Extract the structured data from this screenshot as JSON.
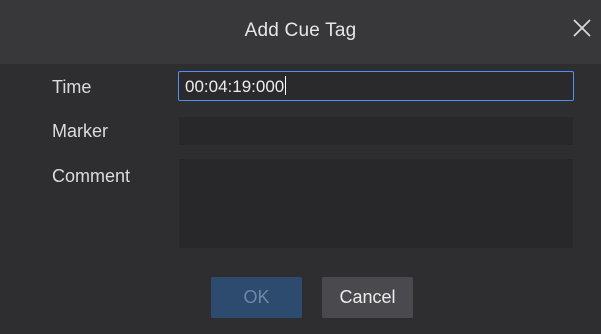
{
  "dialog": {
    "title": "Add Cue Tag",
    "close_icon": "close-icon"
  },
  "form": {
    "time_label": "Time",
    "time_value": "00:04:19:000",
    "marker_label": "Marker",
    "marker_value": "",
    "comment_label": "Comment",
    "comment_value": ""
  },
  "buttons": {
    "ok_label": "OK",
    "ok_state": "disabled",
    "cancel_label": "Cancel"
  },
  "colors": {
    "background": "#2e2e30",
    "titlebar": "#38383a",
    "focus_border": "#4f8ff7",
    "ok_button": "#2d4a6f",
    "cancel_button": "#4a4a4e"
  }
}
